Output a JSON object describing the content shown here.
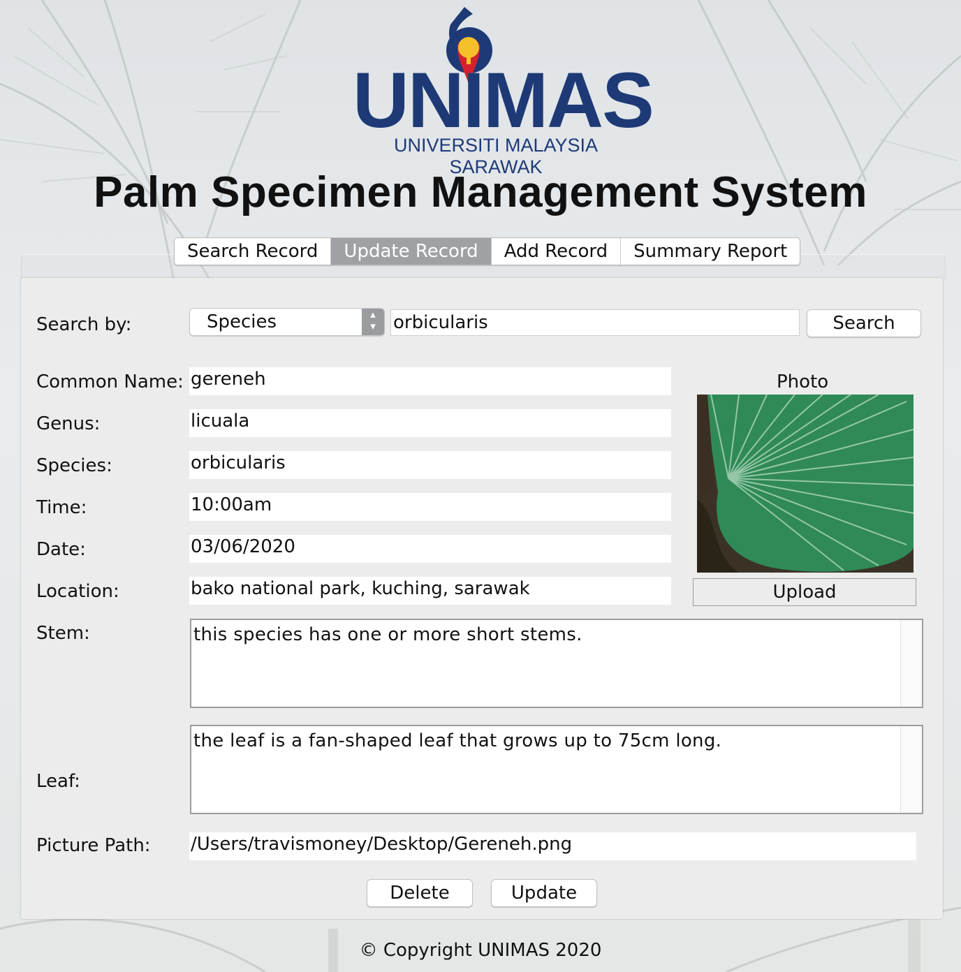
{
  "logo": {
    "wordmark": "UNIMAS",
    "subtitle": "UNIVERSITI MALAYSIA SARAWAK"
  },
  "app_title": "Palm Specimen Management System",
  "tabs": [
    {
      "label": "Search Record",
      "active": false
    },
    {
      "label": "Update Record",
      "active": true
    },
    {
      "label": "Add Record",
      "active": false
    },
    {
      "label": "Summary Report",
      "active": false
    }
  ],
  "search": {
    "label": "Search by:",
    "criteria_selected": "Species",
    "query_value": "orbicularis",
    "button_label": "Search"
  },
  "form": {
    "common_name": {
      "label": "Common Name:",
      "value": "gereneh"
    },
    "genus": {
      "label": "Genus:",
      "value": "licuala"
    },
    "species": {
      "label": "Species:",
      "value": "orbicularis"
    },
    "time": {
      "label": "Time:",
      "value": "10:00am"
    },
    "date": {
      "label": "Date:",
      "value": "03/06/2020"
    },
    "location": {
      "label": "Location:",
      "value": "bako national park, kuching, sarawak"
    },
    "stem": {
      "label": "Stem:",
      "value": "this species has one or more short stems."
    },
    "leaf": {
      "label": "Leaf:",
      "value": "the leaf is a fan-shaped leaf that grows up to 75cm long."
    },
    "picture_path": {
      "label": "Picture Path:",
      "value": "/Users/travismoney/Desktop/Gereneh.png"
    }
  },
  "photo": {
    "label": "Photo",
    "upload_label": "Upload"
  },
  "actions": {
    "delete_label": "Delete",
    "update_label": "Update"
  },
  "footer": {
    "copyright": "© Copyright UNIMAS 2020"
  },
  "colors": {
    "brand_navy": "#1e3a76",
    "brand_red": "#d62030",
    "brand_yellow": "#f6c02b",
    "active_tab": "#9fa1a4",
    "panel": "#ececec"
  }
}
